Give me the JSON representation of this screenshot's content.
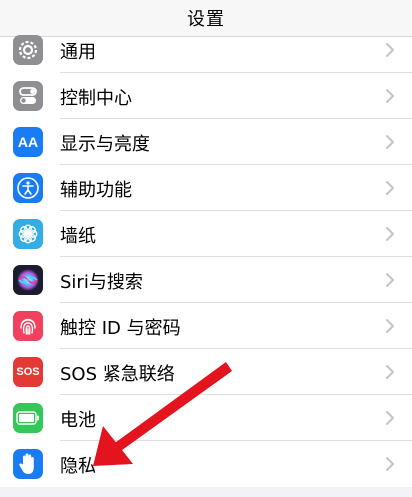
{
  "nav": {
    "title": "设置"
  },
  "items": [
    {
      "label": "通用",
      "icon": "gear-icon",
      "color": "#8e8e93"
    },
    {
      "label": "控制中心",
      "icon": "toggles-icon",
      "color": "#8e8e93"
    },
    {
      "label": "显示与亮度",
      "icon": "aa-icon",
      "color": "#1a7cf2",
      "icon_text": "AA"
    },
    {
      "label": "辅助功能",
      "icon": "accessibility-icon",
      "color": "#1a7cf2"
    },
    {
      "label": "墙纸",
      "icon": "flower-icon",
      "color": "#32ade6"
    },
    {
      "label": "Siri与搜索",
      "icon": "siri-icon",
      "color": "#1c1c2e"
    },
    {
      "label": "触控 ID 与密码",
      "icon": "fingerprint-icon",
      "color": "#f0415e"
    },
    {
      "label": "SOS 紧急联络",
      "icon": "sos-icon",
      "color": "#e53935",
      "icon_text": "SOS"
    },
    {
      "label": "电池",
      "icon": "battery-icon",
      "color": "#34c759"
    },
    {
      "label": "隐私",
      "icon": "hand-icon",
      "color": "#1a7cf2"
    }
  ],
  "annotation": {
    "icon": "red-arrow-icon",
    "color": "#e3141e"
  }
}
